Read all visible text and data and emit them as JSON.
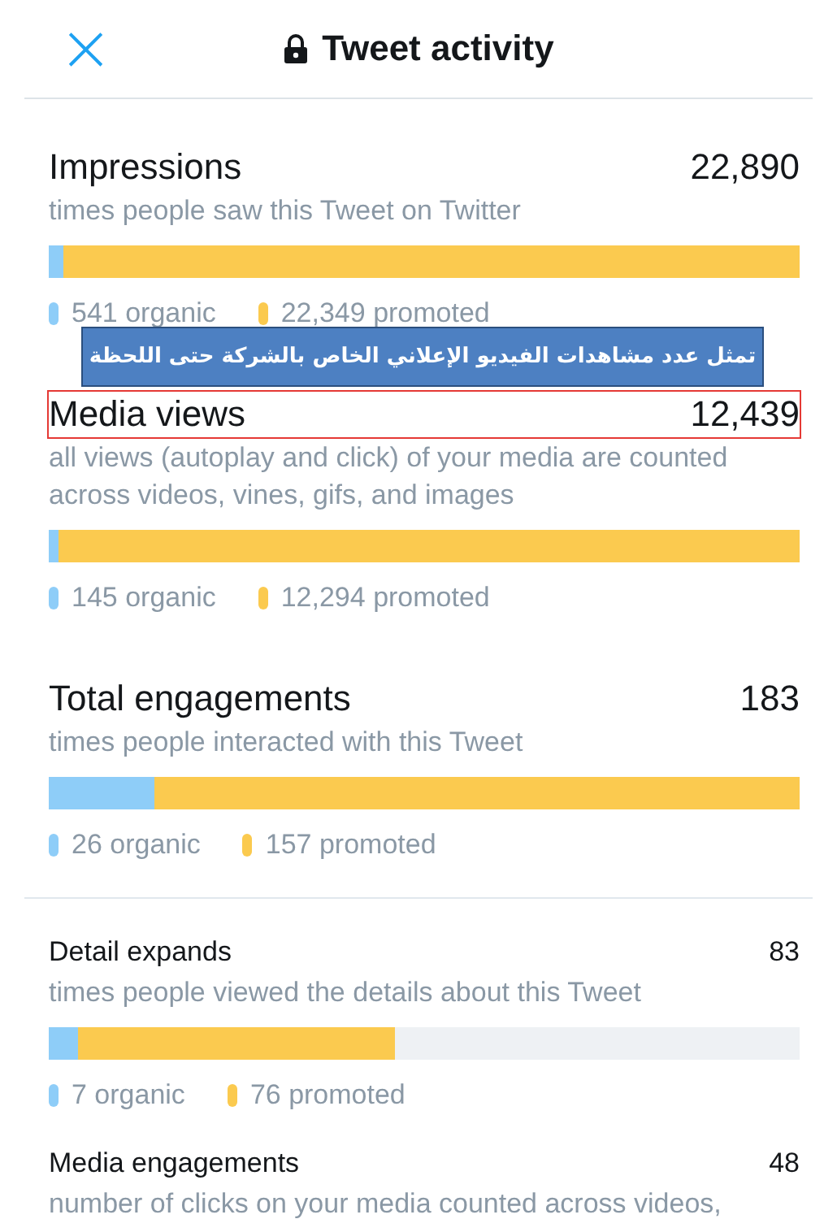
{
  "header": {
    "close": "×",
    "title": "Tweet activity"
  },
  "sections": [
    {
      "metrics": [
        {
          "kind": "large",
          "title": "Impressions",
          "value": "22,890",
          "description": "times people saw this Tweet on Twitter",
          "highlighted": false,
          "callout": "تمثل عدد مشاهدات الفيديو الإعلاني الخاص بالشركة حتى اللحظة",
          "breakdown": [
            {
              "label": "541 organic",
              "color": "#8ecdf8",
              "level": 0.02
            },
            {
              "label": "22,349 promoted",
              "color": "#fbca4f",
              "level": 1
            }
          ]
        },
        {
          "kind": "large",
          "title": "Media views",
          "value": "12,439",
          "description": "all views (autoplay and click) of your media are counted across videos, vines, gifs, and images",
          "highlighted": true,
          "breakdown": [
            {
              "label": "145 organic",
              "color": "#8ecdf8",
              "level": 0.012
            },
            {
              "label": "12,294 promoted",
              "color": "#fbca4f",
              "level": 1
            }
          ]
        },
        {
          "kind": "large",
          "title": "Total engagements",
          "value": "183",
          "description": "times people interacted with this Tweet",
          "highlighted": false,
          "breakdown": [
            {
              "label": "26 organic",
              "color": "#8ecdf8",
              "level": 0.14
            },
            {
              "label": "157 promoted",
              "color": "#fbca4f",
              "level": 1
            }
          ]
        }
      ]
    },
    {
      "metrics": [
        {
          "kind": "small",
          "title": "Detail expands",
          "value": "83",
          "description": "times people viewed the details about this Tweet",
          "highlighted": false,
          "breakdown": [
            {
              "label": "7 organic",
              "color": "#8ecdf8",
              "level": 0.04
            },
            {
              "label": "76 promoted",
              "color": "#fbca4f",
              "level": 0.46
            }
          ]
        },
        {
          "kind": "small",
          "title": "Media engagements",
          "value": "48",
          "description": "number of clicks on your media counted across videos,",
          "highlighted": false
        }
      ]
    }
  ]
}
